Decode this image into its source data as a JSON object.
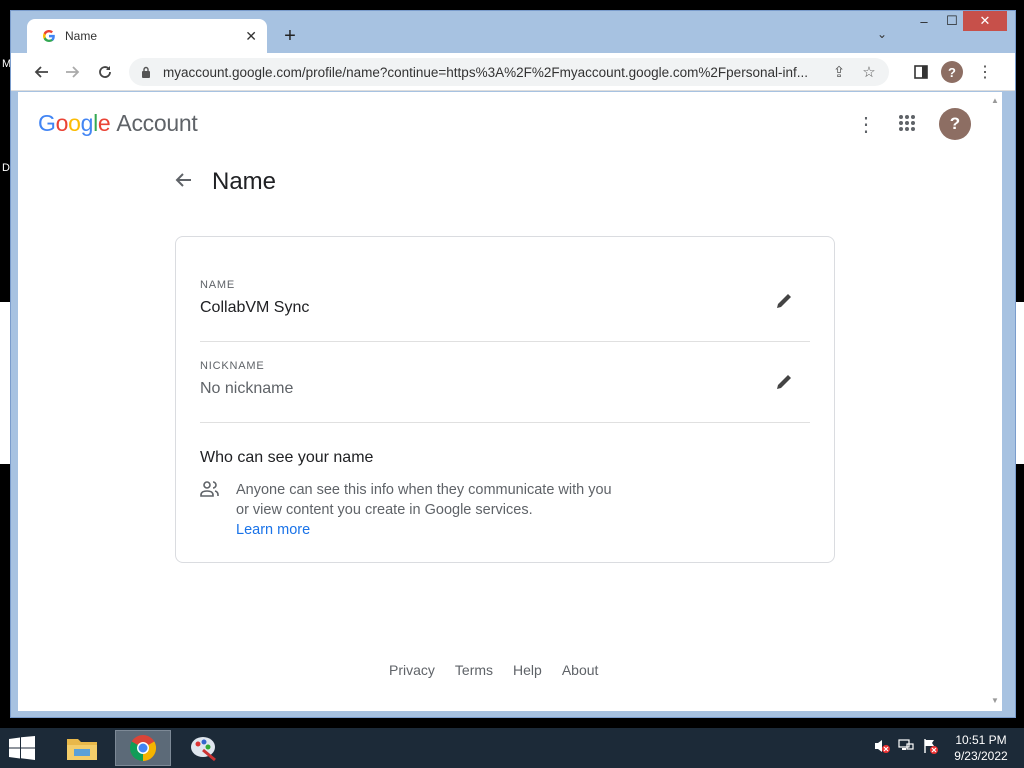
{
  "desktop": {
    "letter_m": "M",
    "letter_d": "D"
  },
  "browser": {
    "tab": {
      "title": "Name",
      "favicon": "google-g-icon"
    },
    "url": "myaccount.google.com/profile/name?continue=https%3A%2F%2Fmyaccount.google.com%2Fpersonal-inf...",
    "profile_initial": "?"
  },
  "header": {
    "logo_letters": [
      "G",
      "o",
      "o",
      "g",
      "l",
      "e"
    ],
    "logo_suffix": "Account",
    "avatar_initial": "?"
  },
  "page": {
    "title": "Name",
    "name_label": "NAME",
    "name_value": "CollabVM Sync",
    "nickname_label": "NICKNAME",
    "nickname_value": "No nickname",
    "who_title": "Who can see your name",
    "who_desc": "Anyone can see this info when they communicate with you or view content you create in Google services.",
    "learn_more": "Learn more"
  },
  "footer": {
    "privacy": "Privacy",
    "terms": "Terms",
    "help": "Help",
    "about": "About"
  },
  "taskbar": {
    "time": "10:51 PM",
    "date": "9/23/2022",
    "apps": [
      "file-explorer-icon",
      "chrome-icon",
      "paint-icon"
    ]
  },
  "colors": {
    "link": "#1a73e8",
    "avatar": "#8d6e63",
    "taskbar": "#1c2a38",
    "window_frame": "#a7c2e1",
    "close_button": "#c7504a"
  }
}
